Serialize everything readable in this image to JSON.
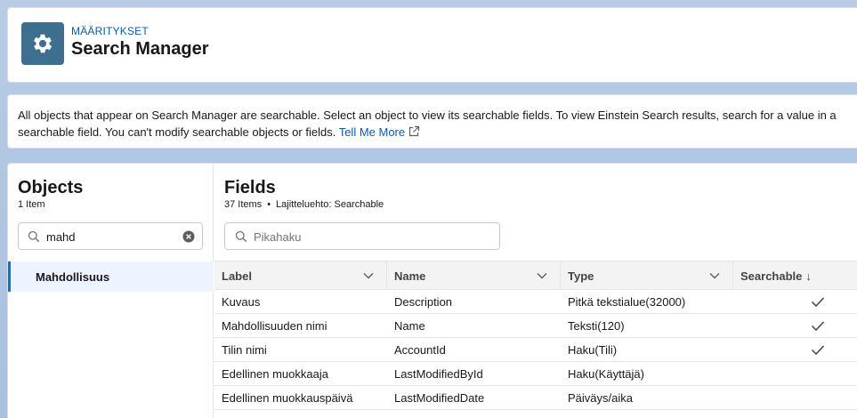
{
  "header": {
    "eyebrow": "MÄÄRITYKSET",
    "title": "Search Manager",
    "icon": "gear-icon"
  },
  "info": {
    "text": "All objects that appear on Search Manager are searchable. Select an object to view its searchable fields. To view Einstein Search results, search for a value in a searchable field. You can't modify searchable objects or fields.",
    "link": "Tell Me More"
  },
  "objects": {
    "title": "Objects",
    "count": "1 Item",
    "search_value": "mahd",
    "items": [
      "Mahdollisuus"
    ]
  },
  "fields": {
    "title": "Fields",
    "count": "37 Items",
    "sort": "Lajitteluehto: Searchable",
    "quick_search_placeholder": "Pikahaku",
    "columns": {
      "label": "Label",
      "name": "Name",
      "type": "Type",
      "searchable": "Searchable",
      "sort_arrow": "↓"
    },
    "rows": [
      {
        "label": "Kuvaus",
        "name": "Description",
        "type": "Pitkä tekstialue(32000)",
        "searchable": true
      },
      {
        "label": "Mahdollisuuden nimi",
        "name": "Name",
        "type": "Teksti(120)",
        "searchable": true
      },
      {
        "label": "Tilin nimi",
        "name": "AccountId",
        "type": "Haku(Tili)",
        "searchable": true
      },
      {
        "label": "Edellinen muokkaaja",
        "name": "LastModifiedById",
        "type": "Haku(Käyttäjä)",
        "searchable": false
      },
      {
        "label": "Edellinen muokkauspäivä",
        "name": "LastModifiedDate",
        "type": "Päiväys/aika",
        "searchable": false
      }
    ]
  },
  "colors": {
    "accent": "#0176d3",
    "link": "#0b5cab",
    "header_icon_bg": "#3f6f8f",
    "selected_bg": "#eef4ff"
  }
}
